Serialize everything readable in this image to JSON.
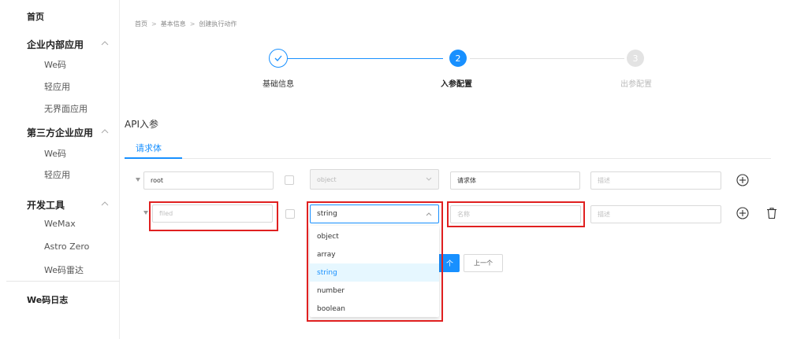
{
  "sidebar": {
    "home": "首页",
    "group1": {
      "title": "企业内部应用",
      "items": [
        "We码",
        "轻应用",
        "无界面应用"
      ]
    },
    "group2": {
      "title": "第三方企业应用",
      "items": [
        "We码",
        "轻应用"
      ]
    },
    "group3": {
      "title": "开发工具",
      "items": [
        "WeMax",
        "Astro Zero",
        "We码雷达"
      ]
    },
    "footer": "We码日志"
  },
  "breadcrumb": [
    "首页",
    "基本信息",
    "创建执行动作"
  ],
  "steps": [
    {
      "label": "基础信息",
      "status": "done",
      "icon": "check-icon"
    },
    {
      "label": "入参配置",
      "status": "active",
      "number": "2"
    },
    {
      "label": "出参配置",
      "status": "pending",
      "number": "3"
    }
  ],
  "section_title": "API入参",
  "tabs": [
    {
      "label": "请求体",
      "active": true
    }
  ],
  "rows": [
    {
      "name_value": "root",
      "type_value": "object",
      "title_value": "请求体",
      "desc_placeholder": "描述"
    },
    {
      "name_placeholder": "filed",
      "type_value": "string",
      "title_placeholder": "名称",
      "desc_placeholder": "描述"
    }
  ],
  "type_options": [
    "object",
    "array",
    "string",
    "number",
    "boolean"
  ],
  "type_selected": "string",
  "buttons": {
    "next_partial": "个",
    "prev": "上一个"
  },
  "colors": {
    "accent": "#1890ff",
    "highlight": "#e02020",
    "step_pending": "#d9d9d9"
  }
}
